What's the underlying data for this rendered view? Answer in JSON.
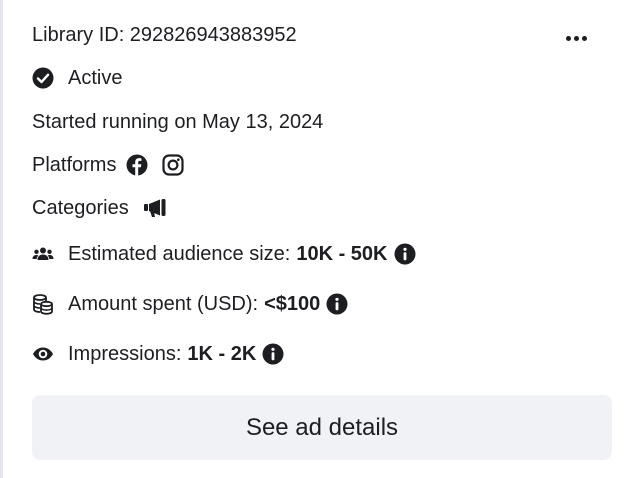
{
  "card": {
    "library_id": "Library ID: 292826943883952",
    "status": "Active",
    "started": "Started running on May 13, 2024",
    "platforms_label": "Platforms",
    "platform_icons": [
      "facebook-icon",
      "instagram-icon"
    ],
    "categories_label": "Categories",
    "category_icon": "megaphone-icon",
    "audience_label": "Estimated audience size:",
    "audience_value": "10K - 50K",
    "spent_label": "Amount spent (USD):",
    "spent_value": "<$100",
    "impressions_label": "Impressions:",
    "impressions_value": "1K - 2K",
    "details_button": "See ad details"
  },
  "colors": {
    "text": "#1c1e21",
    "button_bg": "#f0f2f5",
    "border": "#e4e6eb"
  }
}
